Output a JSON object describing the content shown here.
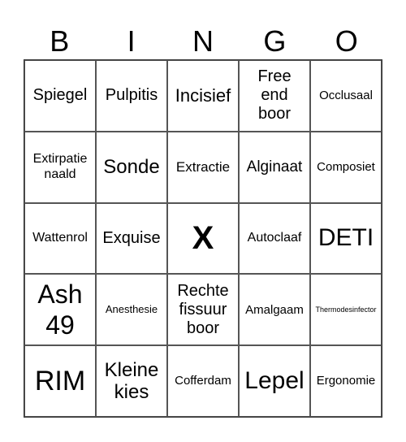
{
  "header": {
    "letters": [
      "B",
      "I",
      "N",
      "G",
      "O"
    ]
  },
  "cells": [
    [
      "Spiegel",
      "Pulpitis",
      "Incisief",
      "Free end boor",
      "Occlusaal"
    ],
    [
      "Extirpatie naald",
      "Sonde",
      "Extractie",
      "Alginaat",
      "Composiet"
    ],
    [
      "Wattenrol",
      "Exquise",
      "X",
      "Autoclaaf",
      "DETI"
    ],
    [
      "Ash 49",
      "Anesthesie",
      "Rechte fissuur boor",
      "Amalgaam",
      "Thermodesinfector"
    ],
    [
      "RIM",
      "Kleine kies",
      "Cofferdam",
      "Lepel",
      "Ergonomie"
    ]
  ]
}
